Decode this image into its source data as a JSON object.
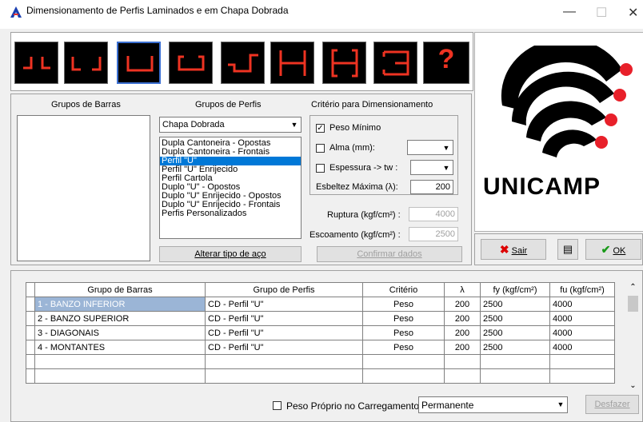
{
  "window": {
    "title": "Dimensionamento de Perfis Laminados e em Chapa Dobrada"
  },
  "toolbar": {
    "help_glyph": "?"
  },
  "logo": {
    "text": "UNICAMP"
  },
  "barras": {
    "heading": "Grupos de Barras"
  },
  "perfis": {
    "heading": "Grupos de Perfis",
    "selected": "Chapa Dobrada",
    "items": [
      "Dupla Cantoneira - Opostas",
      "Dupla Cantoneira - Frontais",
      "Perfil \"U\"",
      "Perfil \"U\" Enrijecido",
      "Perfil Cartola",
      "Duplo \"U\" - Opostos",
      "Duplo \"U\" Enrijecido - Opostos",
      "Duplo \"U\" Enrijecido - Frontais",
      "Perfis Personalizados"
    ],
    "alterar_button": "Alterar tipo de aço"
  },
  "criterio": {
    "heading": "Critério para Dimensionamento",
    "peso_minimo": "Peso Mínimo",
    "alma": "Alma (mm):",
    "espessura": "Espessura -> tw :",
    "esbeltez": "Esbeltez Máxima (λ):",
    "esbeltez_value": "200",
    "ruptura": "Ruptura (kgf/cm²) :",
    "ruptura_value": "4000",
    "escoamento": "Escoamento (kgf/cm²) :",
    "escoamento_value": "2500",
    "confirmar_button": "Confirmar dados"
  },
  "actions": {
    "sair": "Sair",
    "ok": "OK"
  },
  "table": {
    "headers": [
      "Grupo de Barras",
      "Grupo de Perfis",
      "Critério",
      "λ",
      "fy (kgf/cm²)",
      "fu (kgf/cm²)"
    ],
    "rows": [
      [
        "1 - BANZO INFERIOR",
        "CD  - Perfil \"U\"",
        "Peso",
        "200",
        "2500",
        "4000"
      ],
      [
        "2 - BANZO SUPERIOR",
        "CD  - Perfil \"U\"",
        "Peso",
        "200",
        "2500",
        "4000"
      ],
      [
        "3 - DIAGONAIS",
        "CD  - Perfil \"U\"",
        "Peso",
        "200",
        "2500",
        "4000"
      ],
      [
        "4 - MONTANTES",
        "CD  - Perfil \"U\"",
        "Peso",
        "200",
        "2500",
        "4000"
      ]
    ]
  },
  "footer": {
    "peso_proprio": "Peso Próprio no Carregamento :",
    "carregamento": "Permanente",
    "desfazer": "Desfazer"
  }
}
